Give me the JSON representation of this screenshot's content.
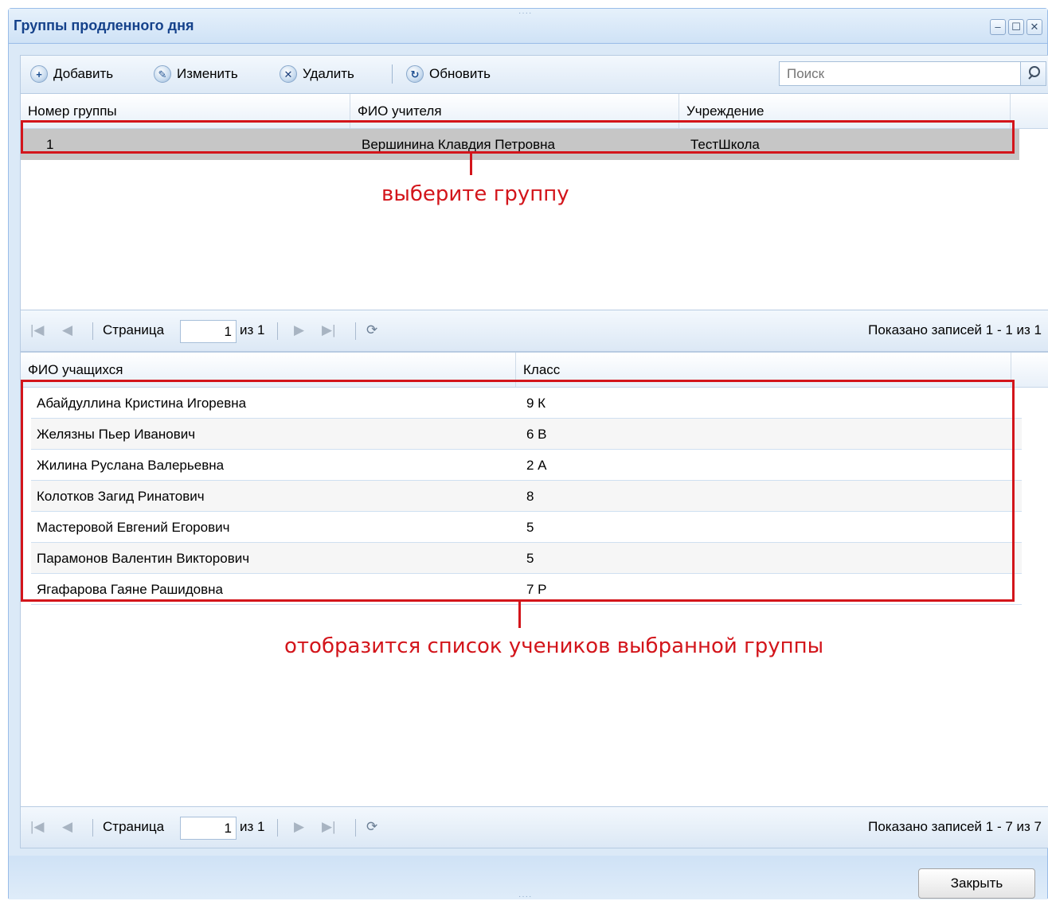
{
  "window": {
    "title": "Группы продленного дня",
    "controls": {
      "minimize": "–",
      "maximize": "☐",
      "close": "✕"
    }
  },
  "toolbar": {
    "add_label": "Добавить",
    "edit_label": "Изменить",
    "delete_label": "Удалить",
    "refresh_label": "Обновить",
    "search_placeholder": "Поиск",
    "icons": [
      "plus-icon",
      "pencil-icon",
      "delete-icon",
      "refresh-icon",
      "search-icon"
    ]
  },
  "groups_grid": {
    "columns": [
      "Номер группы",
      "ФИО учителя",
      "Учреждение"
    ],
    "rows": [
      {
        "number": "1",
        "teacher": "Вершинина Клавдия Петровна",
        "institution": "ТестШкола"
      }
    ]
  },
  "groups_pager": {
    "page_label": "Страница",
    "page_value": "1",
    "of_label": "из 1",
    "info": "Показано записей 1 - 1 из 1"
  },
  "students_grid": {
    "columns": [
      "ФИО учащихся",
      "Класс"
    ],
    "rows": [
      {
        "name": "Абайдуллина Кристина Игоревна",
        "class": "9 К"
      },
      {
        "name": "Желязны Пьер Иванович",
        "class": "6 В"
      },
      {
        "name": "Жилина Руслана Валерьевна",
        "class": "2 А"
      },
      {
        "name": "Колотков Загид Ринатович",
        "class": "8"
      },
      {
        "name": "Мастеровой Евгений Егорович",
        "class": "5"
      },
      {
        "name": "Парамонов Валентин Викторович",
        "class": "5"
      },
      {
        "name": "Ягафарова Гаяне Рашидовна",
        "class": "7 Р"
      }
    ]
  },
  "students_pager": {
    "page_label": "Страница",
    "page_value": "1",
    "of_label": "из 1",
    "info": "Показано записей 1 - 7 из 7"
  },
  "annotations": {
    "select_group": "выберите группу",
    "students_list": "отобразится список учеников выбранной группы"
  },
  "footer": {
    "close_label": "Закрыть"
  },
  "colors": {
    "window_bg": "#dbe9f7",
    "title_text": "#15428b",
    "selected_row": "#c6c6c6",
    "annotation_red": "#d3151b"
  }
}
